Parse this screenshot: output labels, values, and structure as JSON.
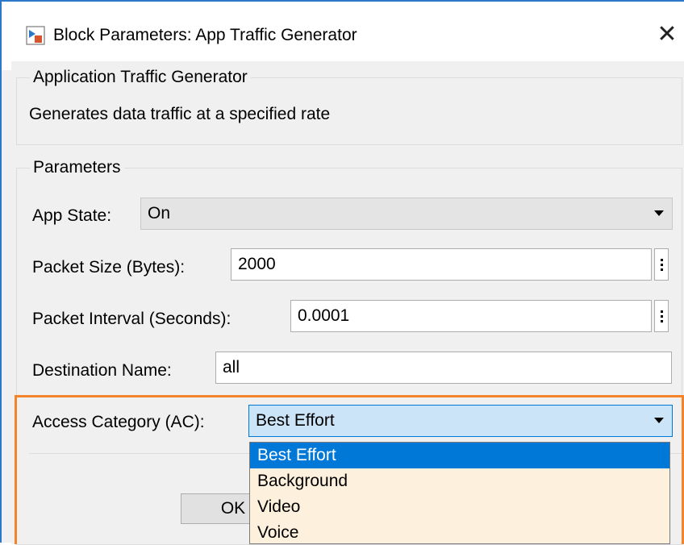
{
  "window": {
    "title": "Block Parameters: App Traffic Generator",
    "close_symbol": "✕"
  },
  "description_group": {
    "legend": "Application Traffic Generator",
    "text": "Generates data traffic at a specified rate"
  },
  "parameters": {
    "legend": "Parameters",
    "app_state": {
      "label": "App State:",
      "value": "On"
    },
    "packet_size": {
      "label": "Packet Size (Bytes):",
      "value": "2000"
    },
    "packet_interval": {
      "label": "Packet Interval (Seconds):",
      "value": "0.0001"
    },
    "destination_name": {
      "label": "Destination Name:",
      "value": "all"
    },
    "access_category": {
      "label": "Access Category (AC):",
      "value": "Best Effort",
      "options": [
        "Best Effort",
        "Background",
        "Video",
        "Voice"
      ],
      "selected_index": 0
    }
  },
  "buttons": {
    "ok": "OK"
  },
  "colors": {
    "highlight_box": "#f5832a",
    "selection": "#0078d7",
    "dropdown_bg": "#fdf0dc"
  },
  "icons": {
    "app_icon": "simulink-block-icon",
    "close": "close-icon"
  }
}
